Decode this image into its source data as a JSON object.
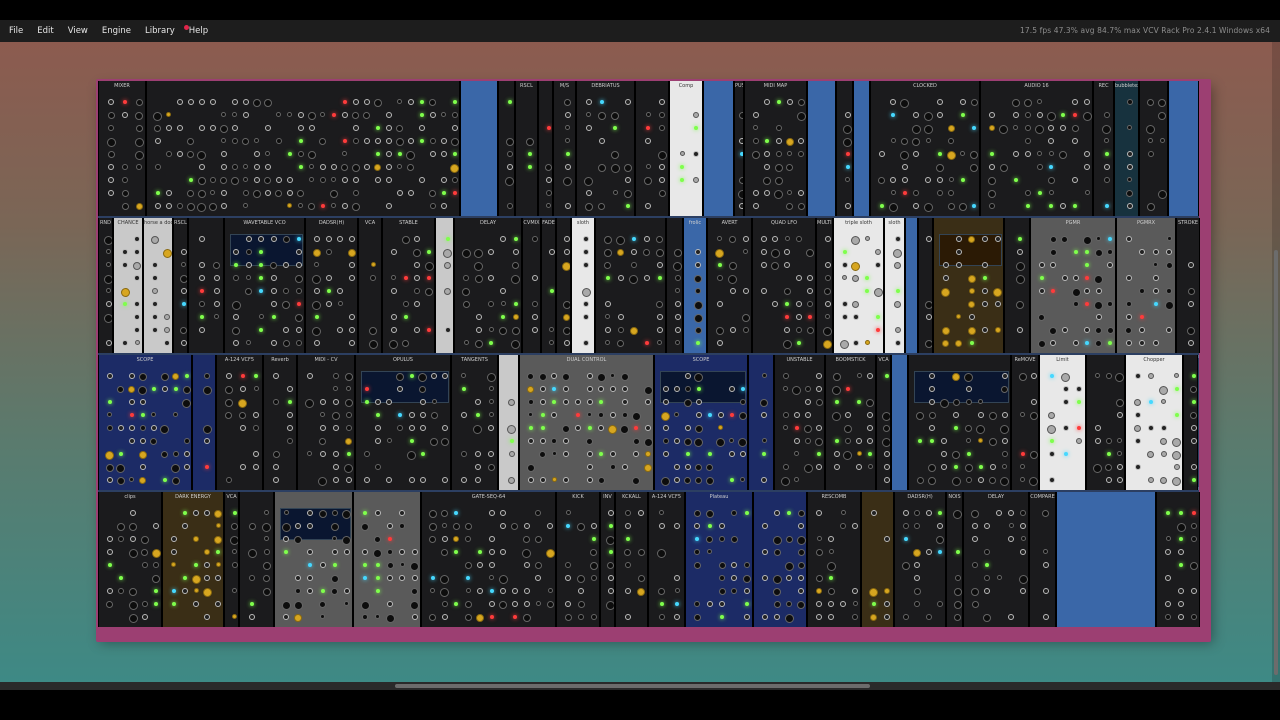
{
  "menu": {
    "items": [
      {
        "id": "file",
        "label": "File"
      },
      {
        "id": "edit",
        "label": "Edit"
      },
      {
        "id": "view",
        "label": "View"
      },
      {
        "id": "engine",
        "label": "Engine"
      },
      {
        "id": "library",
        "label": "Library"
      },
      {
        "id": "help",
        "label": "Help"
      }
    ]
  },
  "status": {
    "text": "17.5 fps  47.3% avg  84.7% max   VCV Rack Pro 2.4.1 Windows x64"
  },
  "colors": {
    "rack_frame": "#9c3f72",
    "rack_bg": "#2c3f62",
    "menubar_bg": "#1d1d1d",
    "notify_dot": "#e0254a"
  },
  "rows": [
    {
      "modules": [
        {
          "label": "MIXER",
          "style": "dark",
          "w": 46
        },
        {
          "label": "",
          "style": "dark",
          "w": 300
        },
        {
          "label": "",
          "style": "blue",
          "w": 36
        },
        {
          "label": "",
          "style": "dark",
          "w": 16
        },
        {
          "label": "RSCL",
          "style": "dark",
          "w": 22
        },
        {
          "label": "",
          "style": "dark",
          "w": 14
        },
        {
          "label": "M/S",
          "style": "dark",
          "w": 22
        },
        {
          "label": "DEBRIATUS",
          "style": "dark",
          "w": 56
        },
        {
          "label": "",
          "style": "dark",
          "w": 32
        },
        {
          "label": "Comp",
          "style": "white",
          "w": 32
        },
        {
          "label": "",
          "style": "blue",
          "w": 30
        },
        {
          "label": "PUSH",
          "style": "dark",
          "w": 10
        },
        {
          "label": "MIDI MAP",
          "style": "dark",
          "w": 60
        },
        {
          "label": "",
          "style": "blue",
          "w": 28
        },
        {
          "label": "",
          "style": "dark",
          "w": 16
        },
        {
          "label": "",
          "style": "blue",
          "w": 16
        },
        {
          "label": "CLOCKED",
          "style": "dark",
          "w": 105
        },
        {
          "label": "AUDIO 16",
          "style": "dark",
          "w": 108
        },
        {
          "label": "REC",
          "style": "dark",
          "w": 20
        },
        {
          "label": "bubbletex",
          "style": "teal",
          "w": 24
        },
        {
          "label": "",
          "style": "dark",
          "w": 28
        },
        {
          "label": "",
          "style": "blue",
          "w": 30
        }
      ]
    },
    {
      "modules": [
        {
          "label": "RND",
          "style": "dark",
          "w": 14
        },
        {
          "label": "CHANCE",
          "style": "light",
          "w": 28
        },
        {
          "label": "horse a doodle",
          "style": "light",
          "w": 28
        },
        {
          "label": "RSCL",
          "style": "dark",
          "w": 14
        },
        {
          "label": "",
          "style": "dark",
          "w": 34
        },
        {
          "label": "WAVETABLE VCO",
          "style": "dark",
          "w": 76
        },
        {
          "label": "DADSR(H)",
          "style": "dark",
          "w": 50
        },
        {
          "label": "VCA",
          "style": "dark",
          "w": 22
        },
        {
          "label": "STABLE",
          "style": "dark",
          "w": 50
        },
        {
          "label": "",
          "style": "light",
          "w": 18
        },
        {
          "label": "DELAY",
          "style": "dark",
          "w": 64
        },
        {
          "label": "CVMIX",
          "style": "dark",
          "w": 18
        },
        {
          "label": "FADE",
          "style": "dark",
          "w": 14
        },
        {
          "label": "",
          "style": "dark",
          "w": 14
        },
        {
          "label": "sloth",
          "style": "white",
          "w": 22
        },
        {
          "label": "",
          "style": "dark",
          "w": 66
        },
        {
          "label": "",
          "style": "dark",
          "w": 16
        },
        {
          "label": "frolic",
          "style": "blue",
          "w": 22
        },
        {
          "label": "AVERT",
          "style": "dark",
          "w": 42
        },
        {
          "label": "QUAD LFO",
          "style": "dark",
          "w": 60
        },
        {
          "label": "MULTI SPLIT",
          "style": "dark",
          "w": 16
        },
        {
          "label": "triple sloth",
          "style": "white",
          "w": 48
        },
        {
          "label": "sloth",
          "style": "white",
          "w": 20
        },
        {
          "label": "",
          "style": "blue",
          "w": 12
        },
        {
          "label": "",
          "style": "dark",
          "w": 14
        },
        {
          "label": "",
          "style": "gold",
          "w": 66
        },
        {
          "label": "",
          "style": "dark",
          "w": 24
        },
        {
          "label": "PGMR",
          "style": "mid",
          "w": 80
        },
        {
          "label": "PGMRX",
          "style": "mid",
          "w": 56
        },
        {
          "label": "STROKE",
          "style": "dark",
          "w": 22
        }
      ]
    },
    {
      "modules": [
        {
          "label": "SCOPE",
          "style": "navy",
          "w": 88
        },
        {
          "label": "",
          "style": "navy",
          "w": 22
        },
        {
          "label": "A-124 VCF5",
          "style": "dark",
          "w": 44
        },
        {
          "label": "Reverb",
          "style": "dark",
          "w": 32
        },
        {
          "label": "MIDI - CV",
          "style": "dark",
          "w": 54
        },
        {
          "label": "OPULUS",
          "style": "dark",
          "w": 90
        },
        {
          "label": "TANGENTS",
          "style": "dark",
          "w": 44
        },
        {
          "label": "",
          "style": "light",
          "w": 20
        },
        {
          "label": "DUAL CONTROL",
          "style": "mid",
          "w": 126
        },
        {
          "label": "SCOPE",
          "style": "navy",
          "w": 88
        },
        {
          "label": "",
          "style": "navy",
          "w": 24
        },
        {
          "label": "UNSTABLE",
          "style": "dark",
          "w": 48
        },
        {
          "label": "BOOMSTICK",
          "style": "dark",
          "w": 48
        },
        {
          "label": "VCA",
          "style": "dark",
          "w": 14
        },
        {
          "label": "",
          "style": "blue",
          "w": 16
        },
        {
          "label": "",
          "style": "dark",
          "w": 96
        },
        {
          "label": "ReMOVE",
          "style": "dark",
          "w": 26
        },
        {
          "label": "Limit",
          "style": "white",
          "w": 44
        },
        {
          "label": "",
          "style": "dark",
          "w": 36
        },
        {
          "label": "Chopper",
          "style": "white",
          "w": 54
        },
        {
          "label": "",
          "style": "dark",
          "w": 14
        }
      ]
    },
    {
      "modules": [
        {
          "label": "clips",
          "style": "dark",
          "w": 62
        },
        {
          "label": "DARK ENERGY",
          "style": "gold",
          "w": 60
        },
        {
          "label": "VCA",
          "style": "dark",
          "w": 14
        },
        {
          "label": "",
          "style": "dark",
          "w": 34
        },
        {
          "label": "",
          "style": "mid",
          "w": 76
        },
        {
          "label": "",
          "style": "mid",
          "w": 66
        },
        {
          "label": "GATE-SEQ-64",
          "style": "dark",
          "w": 130
        },
        {
          "label": "KICK",
          "style": "dark",
          "w": 42
        },
        {
          "label": "INV",
          "style": "dark",
          "w": 14
        },
        {
          "label": "KCKALL",
          "style": "dark",
          "w": 32
        },
        {
          "label": "A-124 VCF5",
          "style": "dark",
          "w": 36
        },
        {
          "label": "Plateau",
          "style": "navy",
          "w": 66
        },
        {
          "label": "",
          "style": "navy",
          "w": 52
        },
        {
          "label": "RESCOMB",
          "style": "dark",
          "w": 52
        },
        {
          "label": "",
          "style": "gold",
          "w": 32
        },
        {
          "label": "DADSR(H)",
          "style": "dark",
          "w": 50
        },
        {
          "label": "NOIS",
          "style": "dark",
          "w": 16
        },
        {
          "label": "DELAY",
          "style": "dark",
          "w": 64
        },
        {
          "label": "COMPARE",
          "style": "dark",
          "w": 26
        },
        {
          "label": "",
          "style": "blue",
          "w": 96
        },
        {
          "label": "",
          "style": "dark",
          "w": 42
        }
      ]
    }
  ]
}
